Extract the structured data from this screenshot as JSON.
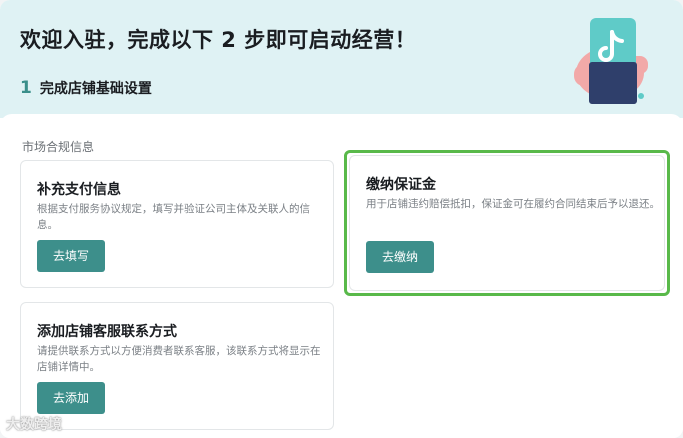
{
  "header": {
    "title": "欢迎入驻，完成以下 2 步即可启动经营！",
    "step_number": "1",
    "step_label": "完成店铺基础设置"
  },
  "section": {
    "label": "市场合规信息"
  },
  "cards": {
    "payment": {
      "title": "补充支付信息",
      "description": "根据支付服务协议规定，填写并验证公司主体及关联人的信息。",
      "button": "去填写"
    },
    "deposit": {
      "title": "缴纳保证金",
      "description": "用于店铺违约赔偿抵扣，保证金可在履约合同结束后予以退还。",
      "button": "去缴纳"
    },
    "service": {
      "title": "添加店铺客服联系方式",
      "description": "请提供联系方式以方便消费者联系客服，该联系方式将显示在店铺详情中。",
      "button": "去添加"
    }
  },
  "icons": [
    "tiktok-phone-illustration"
  ],
  "colors": {
    "accent": "#3d8f8b",
    "hero_bg": "#dff2f4",
    "highlight_border": "#59b94a"
  },
  "watermark": "大数跨境"
}
